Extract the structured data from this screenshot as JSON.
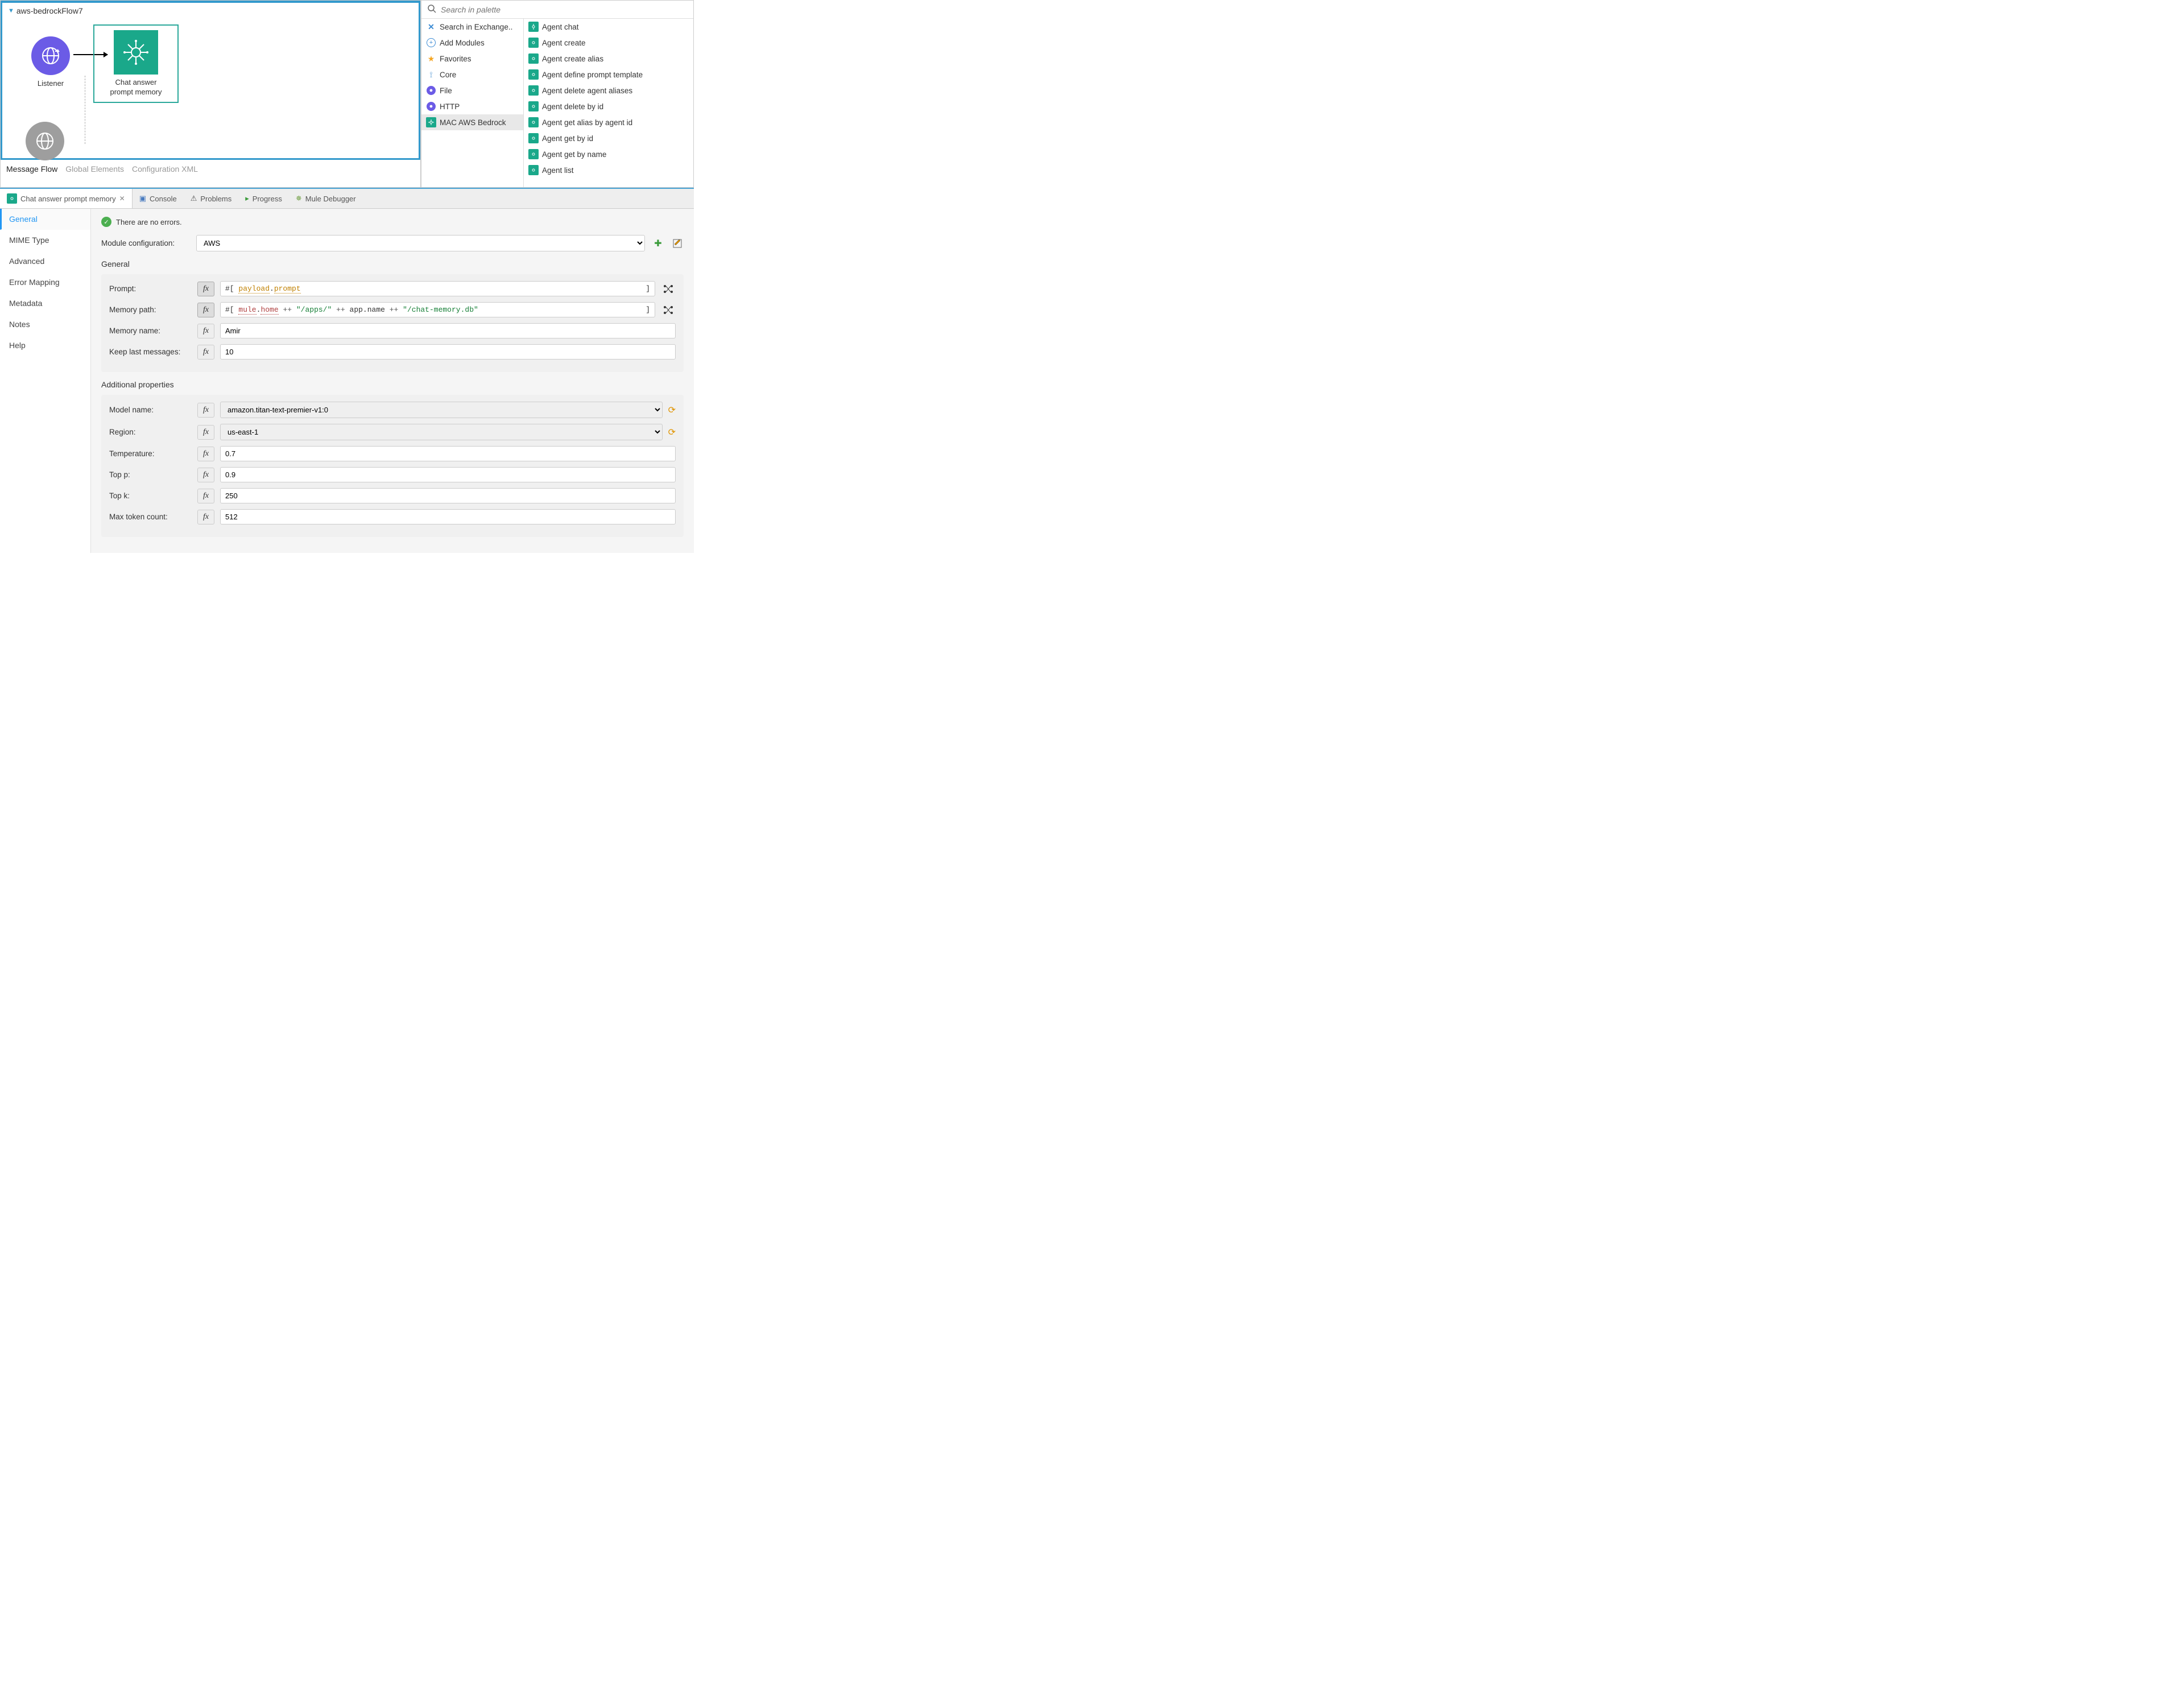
{
  "flow": {
    "title": "aws-bedrockFlow7",
    "listener_label": "Listener",
    "chat_label_l1": "Chat answer",
    "chat_label_l2": "prompt memory",
    "tabs": [
      "Message Flow",
      "Global Elements",
      "Configuration XML"
    ],
    "active_tab": 0
  },
  "palette": {
    "search_placeholder": "Search in palette",
    "left": [
      {
        "label": "Search in Exchange..",
        "icon": "exchange"
      },
      {
        "label": "Add Modules",
        "icon": "plus"
      },
      {
        "label": "Favorites",
        "icon": "star"
      },
      {
        "label": "Core",
        "icon": "core"
      },
      {
        "label": "File",
        "icon": "file"
      },
      {
        "label": "HTTP",
        "icon": "http"
      },
      {
        "label": "MAC AWS Bedrock",
        "icon": "bedrock",
        "selected": true
      }
    ],
    "right": [
      "Agent chat",
      "Agent create",
      "Agent create alias",
      "Agent define prompt template",
      "Agent delete agent aliases",
      "Agent delete by id",
      "Agent get alias by agent id",
      "Agent get by id",
      "Agent get by name",
      "Agent list"
    ]
  },
  "props": {
    "tabs": {
      "active": "Chat answer prompt memory",
      "others": [
        "Console",
        "Problems",
        "Progress",
        "Mule Debugger"
      ]
    },
    "sidebar": [
      "General",
      "MIME Type",
      "Advanced",
      "Error Mapping",
      "Metadata",
      "Notes",
      "Help"
    ],
    "sidebar_active": 0,
    "status": "There are no errors.",
    "module_config_label": "Module configuration:",
    "module_config_value": "AWS",
    "general_title": "General",
    "fields": {
      "prompt": {
        "label": "Prompt:",
        "prefix": "#[ ",
        "tokens": [
          {
            "t": "payload",
            "c": "key"
          },
          {
            "t": ".",
            "c": "op"
          },
          {
            "t": "prompt",
            "c": "key"
          }
        ],
        "suffix": " ]"
      },
      "memory_path": {
        "label": "Memory path:",
        "prefix": "#[ ",
        "tokens": [
          {
            "t": "mule",
            "c": "var"
          },
          {
            "t": ".",
            "c": "op"
          },
          {
            "t": "home",
            "c": "var"
          },
          {
            "t": " ++ ",
            "c": "op"
          },
          {
            "t": "\"/apps/\"",
            "c": "str"
          },
          {
            "t": " ++ ",
            "c": "op"
          },
          {
            "t": "app",
            "c": "op"
          },
          {
            "t": ".",
            "c": "op"
          },
          {
            "t": "name",
            "c": "op"
          },
          {
            "t": " ++ ",
            "c": "op"
          },
          {
            "t": "\"/chat-memory.db\"",
            "c": "str"
          }
        ],
        "suffix": " ]"
      },
      "memory_name": {
        "label": "Memory name:",
        "value": "Amir"
      },
      "keep_last": {
        "label": "Keep last messages:",
        "value": "10"
      }
    },
    "additional_title": "Additional properties",
    "additional": {
      "model_name": {
        "label": "Model name:",
        "value": "amazon.titan-text-premier-v1:0"
      },
      "region": {
        "label": "Region:",
        "value": "us-east-1"
      },
      "temperature": {
        "label": "Temperature:",
        "value": "0.7"
      },
      "top_p": {
        "label": "Top p:",
        "value": "0.9"
      },
      "top_k": {
        "label": "Top k:",
        "value": "250"
      },
      "max_tokens": {
        "label": "Max token count:",
        "value": "512"
      }
    }
  }
}
